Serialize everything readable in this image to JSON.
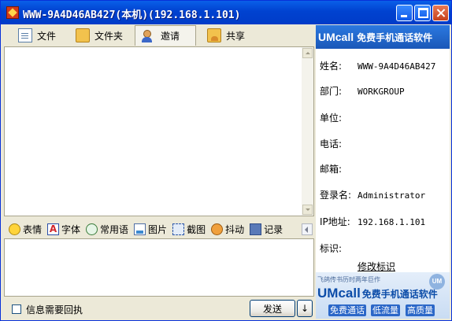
{
  "window": {
    "title": "WWW-9A4D46AB427(本机)(192.168.1.101)"
  },
  "tabs": [
    {
      "label": "文件",
      "icon": "file-icon"
    },
    {
      "label": "文件夹",
      "icon": "folder-icon"
    },
    {
      "label": "邀请",
      "icon": "invite-icon",
      "active": true
    },
    {
      "label": "共享",
      "icon": "share-folder-icon"
    }
  ],
  "toolbar": {
    "items": [
      {
        "label": "表情",
        "icon": "smiley-icon"
      },
      {
        "label": "字体",
        "icon": "font-icon",
        "glyph": "A"
      },
      {
        "label": "常用语",
        "icon": "speech-bubble-icon"
      },
      {
        "label": "图片",
        "icon": "picture-icon"
      },
      {
        "label": "截图",
        "icon": "screenshot-icon"
      },
      {
        "label": "抖动",
        "icon": "shake-icon"
      },
      {
        "label": "记录",
        "icon": "record-icon"
      }
    ]
  },
  "bottom": {
    "receipt_label": "信息需要回执",
    "receipt_checked": false,
    "send_label": "发送",
    "send_menu_glyph": "↓"
  },
  "right_panel": {
    "banner_top": {
      "brand": "UMcall",
      "slogan": "免费手机通话软件"
    },
    "info": [
      {
        "label": "姓名:",
        "value": "WWW-9A4D46AB427"
      },
      {
        "label": "部门:",
        "value": "WORKGROUP"
      },
      {
        "label": "单位:",
        "value": ""
      },
      {
        "label": "电话:",
        "value": ""
      },
      {
        "label": "邮箱:",
        "value": ""
      },
      {
        "label": "登录名:",
        "value": "Administrator"
      },
      {
        "label": "IP地址:",
        "value": "192.168.1.101"
      },
      {
        "label": "标识:",
        "value": ""
      }
    ],
    "edit_link": "修改标识",
    "banner_bottom": {
      "subtitle": "飞鸽传书历时两年巨作",
      "badge": "UM",
      "brand": "UMcall",
      "slogan": "免费手机通话软件",
      "features": [
        "免费通话",
        "低流量",
        "高质量"
      ]
    }
  },
  "colors": {
    "title_bar": "#0042D0",
    "banner_blue": "#1A57B8",
    "window_bg": "#ECE9D8"
  }
}
